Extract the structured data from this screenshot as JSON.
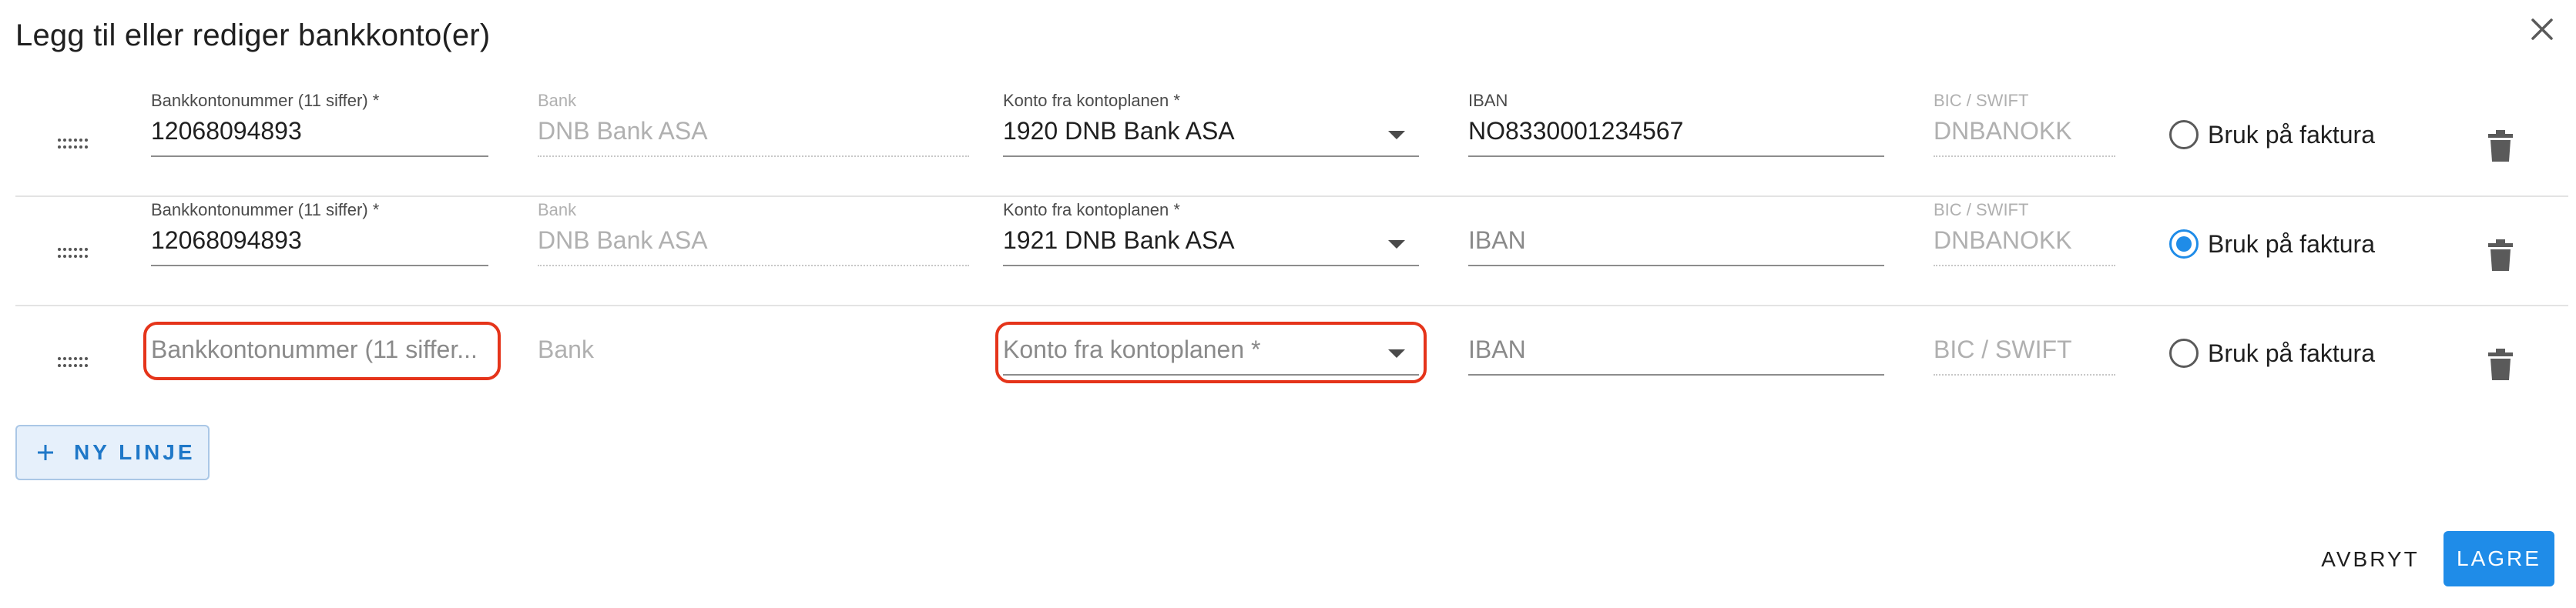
{
  "dialog": {
    "title": "Legg til eller rediger bankkonto(er)",
    "close_icon": "close-icon"
  },
  "rows": [
    {
      "account_number": {
        "label": "Bankkontonummer (11 siffer) *",
        "value": "12068094893"
      },
      "bank": {
        "label": "Bank",
        "value": "DNB Bank ASA"
      },
      "ledger_account": {
        "label": "Konto fra kontoplanen *",
        "value": "1920 DNB Bank ASA"
      },
      "iban": {
        "label": "IBAN",
        "value": "NO8330001234567"
      },
      "bic": {
        "label": "BIC / SWIFT",
        "value": "DNBANOKK"
      },
      "use_on_invoice": {
        "label": "Bruk på faktura",
        "selected": false
      }
    },
    {
      "account_number": {
        "label": "Bankkontonummer (11 siffer) *",
        "value": "12068094893"
      },
      "bank": {
        "label": "Bank",
        "value": "DNB Bank ASA"
      },
      "ledger_account": {
        "label": "Konto fra kontoplanen *",
        "value": "1921 DNB Bank ASA"
      },
      "iban": {
        "placeholder": "IBAN",
        "value": ""
      },
      "bic": {
        "label": "BIC / SWIFT",
        "value": "DNBANOKK"
      },
      "use_on_invoice": {
        "label": "Bruk på faktura",
        "selected": true
      }
    },
    {
      "account_number": {
        "placeholder": "Bankkontonummer (11 siffer...",
        "value": "",
        "error": true
      },
      "bank": {
        "placeholder": "Bank",
        "value": ""
      },
      "ledger_account": {
        "placeholder": "Konto fra kontoplanen *",
        "value": "",
        "error": true
      },
      "iban": {
        "placeholder": "IBAN",
        "value": ""
      },
      "bic": {
        "placeholder": "BIC / SWIFT",
        "value": ""
      },
      "use_on_invoice": {
        "label": "Bruk på faktura",
        "selected": false
      }
    }
  ],
  "actions": {
    "new_line": "NY LINJE",
    "cancel": "AVBRYT",
    "save": "LAGRE"
  },
  "colors": {
    "accent": "#1f8ce8",
    "error": "#e5341a",
    "new_line_bg": "#e6f0fb"
  }
}
